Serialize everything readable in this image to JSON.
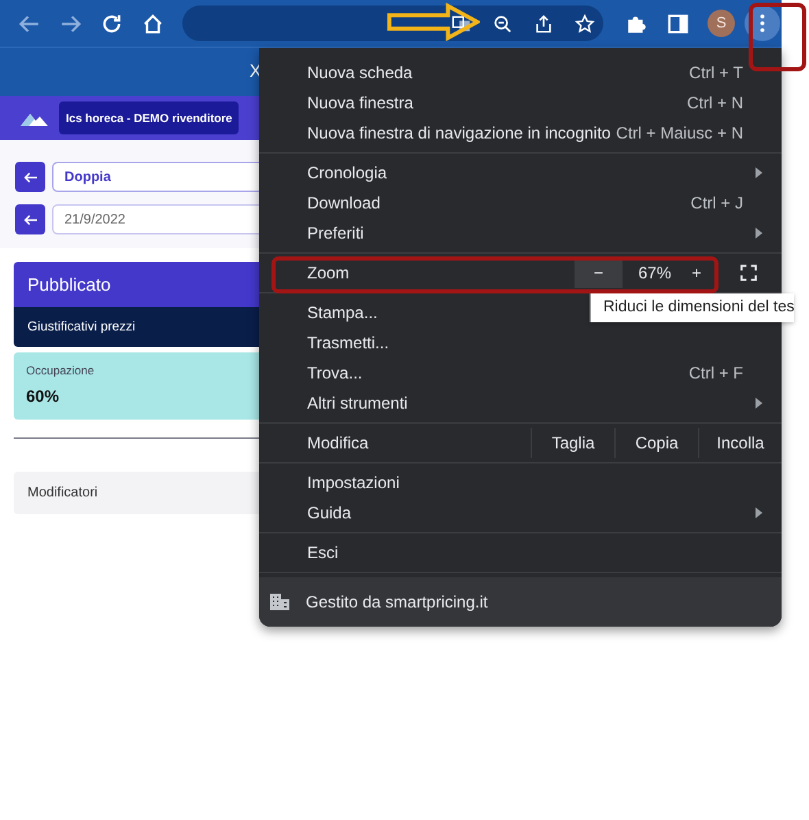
{
  "browser": {
    "avatar_initial": "S",
    "second_bar_glyph": "X"
  },
  "page": {
    "account": "Ics horeca - DEMO rivenditore",
    "fields": [
      {
        "value": "Doppia",
        "kind": "select"
      },
      {
        "value": "21/9/2022",
        "kind": "date"
      }
    ],
    "status_card": {
      "title": "Pubblicato",
      "subtitle": "Giustificativi prezzi"
    },
    "occupancy": {
      "label": "Occupazione",
      "value": "60%"
    },
    "modifiers": "Modificatori"
  },
  "menu": {
    "sections": [
      [
        {
          "kind": "item",
          "label": "Nuova scheda",
          "shortcut": "Ctrl + T",
          "submenu": false
        },
        {
          "kind": "item",
          "label": "Nuova finestra",
          "shortcut": "Ctrl + N",
          "submenu": false
        },
        {
          "kind": "item",
          "label": "Nuova finestra di navigazione in incognito",
          "shortcut": "Ctrl + Maiusc + N",
          "submenu": false
        }
      ],
      [
        {
          "kind": "item",
          "label": "Cronologia",
          "submenu": true
        },
        {
          "kind": "item",
          "label": "Download",
          "shortcut": "Ctrl + J",
          "submenu": false
        },
        {
          "kind": "item",
          "label": "Preferiti",
          "submenu": true
        }
      ],
      [
        {
          "kind": "zoom",
          "label": "Zoom",
          "minus": "−",
          "value": "67%",
          "plus": "+",
          "minus_hovered": true
        }
      ],
      [
        {
          "kind": "item",
          "label": "Stampa...",
          "submenu": false
        },
        {
          "kind": "item",
          "label": "Trasmetti...",
          "submenu": false
        },
        {
          "kind": "item",
          "label": "Trova...",
          "shortcut": "Ctrl + F",
          "submenu": false
        },
        {
          "kind": "item",
          "label": "Altri strumenti",
          "submenu": true
        }
      ],
      [
        {
          "kind": "edit",
          "label": "Modifica",
          "actions": [
            "Taglia",
            "Copia",
            "Incolla"
          ]
        }
      ],
      [
        {
          "kind": "item",
          "label": "Impostazioni",
          "submenu": false
        },
        {
          "kind": "item",
          "label": "Guida",
          "submenu": true
        }
      ],
      [
        {
          "kind": "item",
          "label": "Esci",
          "submenu": false
        }
      ],
      [
        {
          "kind": "managed",
          "label": "Gestito da smartpricing.it"
        }
      ]
    ]
  },
  "tooltip": "Riduci le dimensioni del tes"
}
